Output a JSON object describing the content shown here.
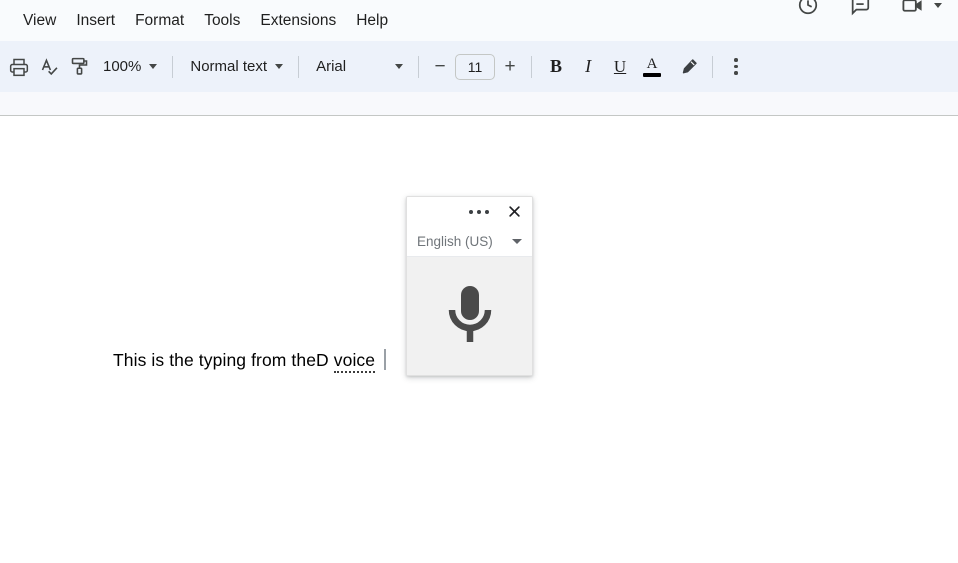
{
  "menubar": {
    "items": [
      {
        "label": "View",
        "name": "menu-view"
      },
      {
        "label": "Insert",
        "name": "menu-insert"
      },
      {
        "label": "Format",
        "name": "menu-format"
      },
      {
        "label": "Tools",
        "name": "menu-tools"
      },
      {
        "label": "Extensions",
        "name": "menu-extensions"
      },
      {
        "label": "Help",
        "name": "menu-help"
      }
    ],
    "right_icons": [
      {
        "icon": "version-history-icon"
      },
      {
        "icon": "comment-icon"
      },
      {
        "icon": "video-camera-icon"
      }
    ]
  },
  "toolbar": {
    "print_icon": "print-icon",
    "spellcheck_icon": "spellcheck-icon",
    "paint_format_icon": "paint-format-icon",
    "zoom_value": "100%",
    "style_value": "Normal text",
    "font_value": "Arial",
    "font_size_decrease": "−",
    "font_size_value": "11",
    "font_size_increase": "+",
    "bold_label": "B",
    "italic_label": "I",
    "underline_label": "U",
    "text_color_label": "A",
    "text_color_swatch": "#000000",
    "highlight_icon": "highlighter-icon",
    "more_icon": "more-vertical-icon"
  },
  "document": {
    "text_before": "This is the typing from theD ",
    "misspelled_word": "voice"
  },
  "voice_popup": {
    "drag_handle_icon": "drag-dots-icon",
    "close_icon": "close-icon",
    "language": "English (US)",
    "mic_icon": "microphone-icon",
    "mic_color": "#4a4a4a",
    "mic_background": "#f1f1f1"
  }
}
